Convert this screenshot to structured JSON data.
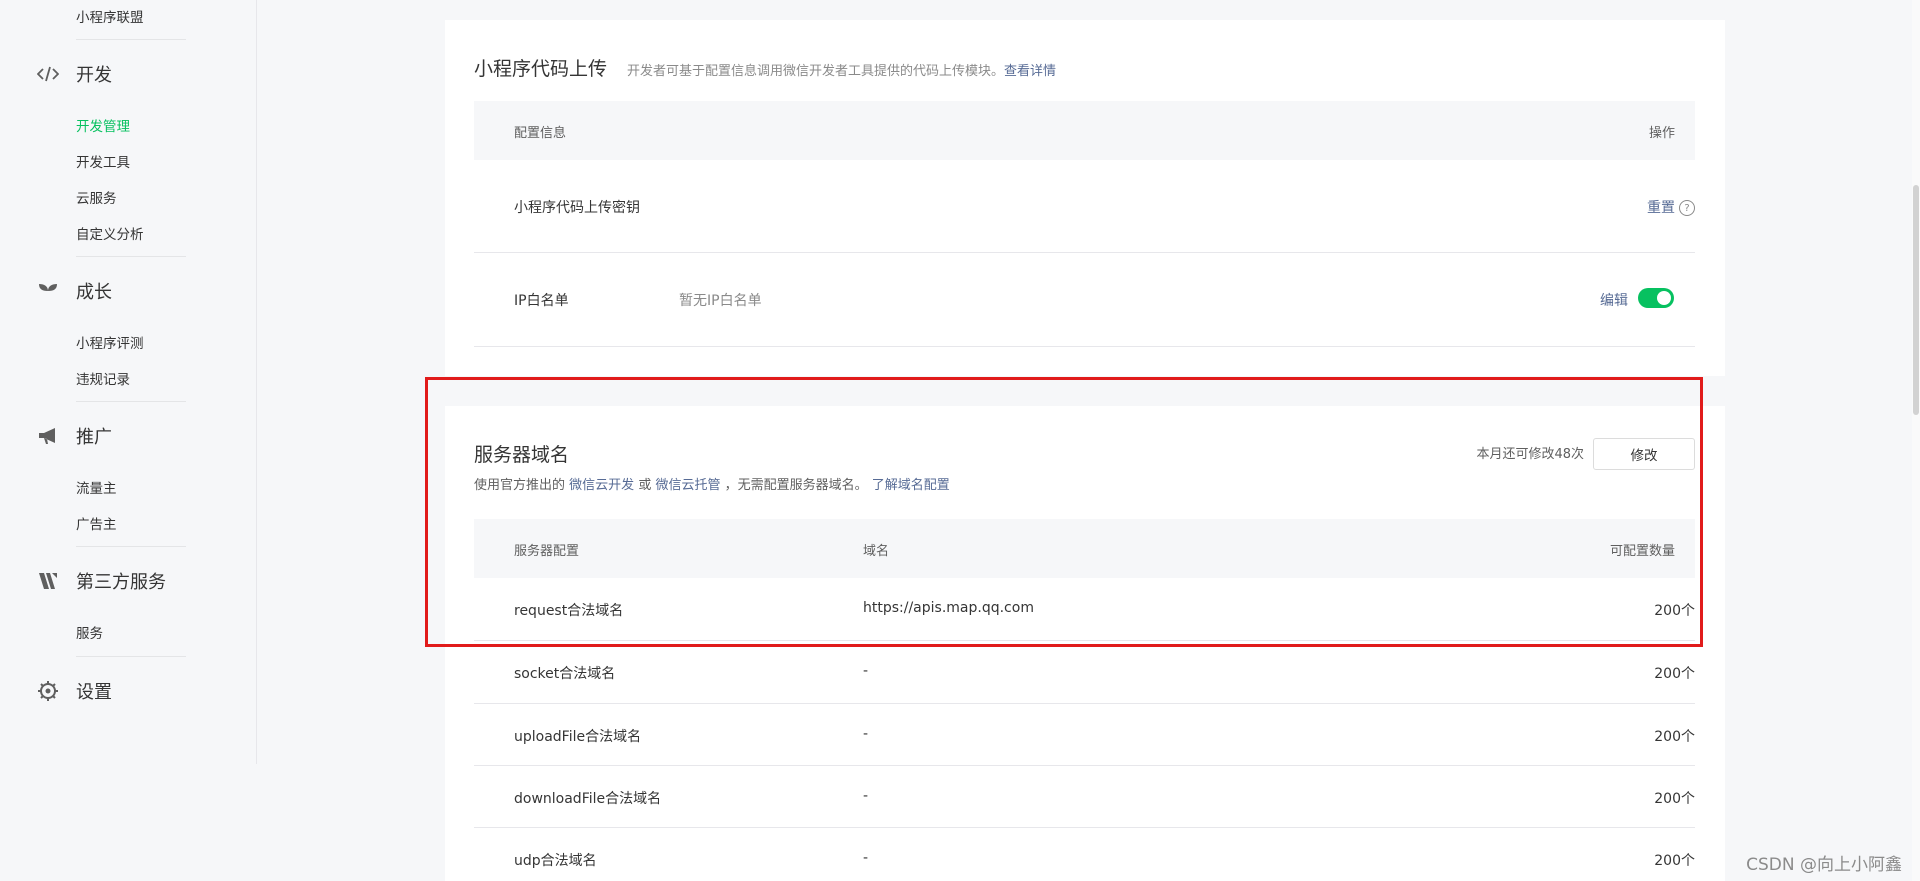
{
  "sidebar": {
    "top_item": "小程序联盟",
    "sections": [
      {
        "title": "开发",
        "icon": "code-icon",
        "items": [
          "开发管理",
          "开发工具",
          "云服务",
          "自定义分析"
        ],
        "active_index": 0
      },
      {
        "title": "成长",
        "icon": "sprout-icon",
        "items": [
          "小程序评测",
          "违规记录"
        ]
      },
      {
        "title": "推广",
        "icon": "megaphone-icon",
        "items": [
          "流量主",
          "广告主"
        ]
      },
      {
        "title": "第三方服务",
        "icon": "third-party-icon",
        "items": [
          "服务"
        ]
      },
      {
        "title": "设置",
        "icon": "gear-icon",
        "items": []
      }
    ]
  },
  "upload_card": {
    "title": "小程序代码上传",
    "desc": "开发者可基于配置信息调用微信开发者工具提供的代码上传模块。",
    "desc_link": "查看详情",
    "header_config": "配置信息",
    "header_action": "操作",
    "key_row": {
      "label": "小程序代码上传密钥",
      "action": "重置",
      "help": "?"
    },
    "ip_row": {
      "label": "IP白名单",
      "value": "暂无IP白名单",
      "action": "编辑",
      "toggle_on": true
    }
  },
  "domain_card": {
    "title": "服务器域名",
    "remaining": "本月还可修改48次",
    "modify_button": "修改",
    "sub_prefix": "使用官方推出的",
    "sub_link1": "微信云开发",
    "sub_or": "或",
    "sub_link2": "微信云托管",
    "sub_suffix": "，无需配置服务器域名。",
    "sub_link3": "了解域名配置",
    "headers": {
      "config": "服务器配置",
      "domain": "域名",
      "count": "可配置数量"
    },
    "rows": [
      {
        "name": "request合法域名",
        "domain": "https://apis.map.qq.com",
        "count": "200个"
      },
      {
        "name": "socket合法域名",
        "domain": "-",
        "count": "200个"
      },
      {
        "name": "uploadFile合法域名",
        "domain": "-",
        "count": "200个"
      },
      {
        "name": "downloadFile合法域名",
        "domain": "-",
        "count": "200个"
      },
      {
        "name": "udp合法域名",
        "domain": "-",
        "count": "200个"
      }
    ]
  },
  "watermark": "CSDN @向上小阿鑫",
  "colors": {
    "accent": "#07c160",
    "link": "#576b95",
    "highlight": "#e11b1b"
  }
}
